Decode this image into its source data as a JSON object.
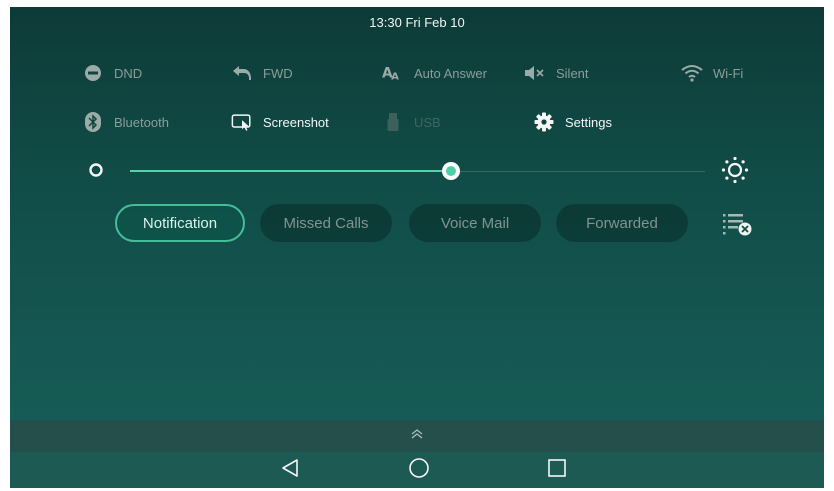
{
  "status_bar": {
    "datetime": "13:30 Fri Feb 10"
  },
  "quick_settings": {
    "dnd": {
      "label": "DND",
      "icon": "minus-circle-icon"
    },
    "fwd": {
      "label": "FWD",
      "icon": "forward-arrow-icon"
    },
    "auto_answer": {
      "label": "Auto Answer",
      "icon": "auto-answer-icon"
    },
    "silent": {
      "label": "Silent",
      "icon": "speaker-muted-icon"
    },
    "wifi": {
      "label": "Wi-Fi",
      "icon": "wifi-icon"
    },
    "bluetooth": {
      "label": "Bluetooth",
      "icon": "bluetooth-icon"
    },
    "screenshot": {
      "label": "Screenshot",
      "icon": "screenshot-icon"
    },
    "usb": {
      "label": "USB",
      "icon": "usb-icon"
    },
    "settings": {
      "label": "Settings",
      "icon": "gear-icon"
    }
  },
  "brightness": {
    "level_fraction": 0.57,
    "min_icon": "brightness-low-icon",
    "max_icon": "brightness-high-icon"
  },
  "tabs": [
    {
      "label": "Notification",
      "active": true
    },
    {
      "label": "Missed Calls",
      "active": false
    },
    {
      "label": "Voice Mail",
      "active": false
    },
    {
      "label": "Forwarded",
      "active": false
    }
  ],
  "clear_all_icon": "clear-all-icon",
  "nav": {
    "back_icon": "back-triangle-icon",
    "home_icon": "home-circle-icon",
    "recents_icon": "recents-square-icon"
  },
  "colors": {
    "accent": "#4fcfa8",
    "background_top": "#0d3b37",
    "background_bottom": "#176059",
    "active_text": "#f4f7f6",
    "inactive_text": "#8b9d9a"
  }
}
